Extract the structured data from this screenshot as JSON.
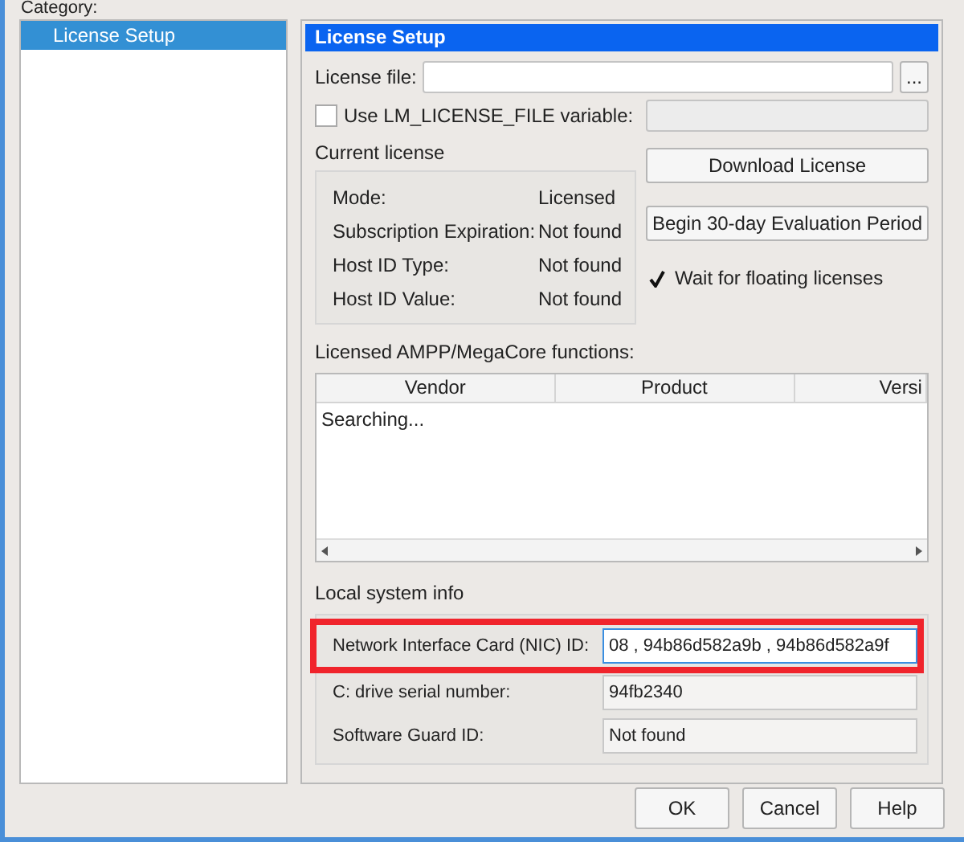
{
  "category_label": "Category:",
  "sidebar": {
    "items": [
      {
        "label": "License Setup",
        "selected": true
      }
    ]
  },
  "panel": {
    "title": "License Setup",
    "license_file": {
      "label": "License file:",
      "browse": "..."
    },
    "lm_license": {
      "label": "Use LM_LICENSE_FILE variable:",
      "checked": false
    },
    "current_license": {
      "title": "Current license",
      "rows": [
        {
          "label": "Mode:",
          "value": "Licensed"
        },
        {
          "label": "Subscription Expiration:",
          "value": "Not found"
        },
        {
          "label": "Host ID Type:",
          "value": "Not found"
        },
        {
          "label": "Host ID Value:",
          "value": "Not found"
        }
      ]
    },
    "actions": [
      "Download License",
      "Begin 30-day Evaluation Period"
    ],
    "wait_floating": {
      "label": "Wait for floating licenses",
      "checked": true
    },
    "functions": {
      "title": "Licensed AMPP/MegaCore functions:",
      "columns": [
        "Vendor",
        "Product",
        "Versi"
      ],
      "status": "Searching..."
    },
    "local_info": {
      "title": "Local system info",
      "rows": [
        {
          "label": "Network Interface Card (NIC) ID:",
          "value": "08 , 94b86d582a9b , 94b86d582a9f",
          "highlighted": true
        },
        {
          "label": "C: drive serial number:",
          "value": "94fb2340",
          "highlighted": false
        },
        {
          "label": "Software Guard ID:",
          "value": "Not found",
          "highlighted": false
        }
      ]
    }
  },
  "buttons": [
    "OK",
    "Cancel",
    "Help"
  ]
}
